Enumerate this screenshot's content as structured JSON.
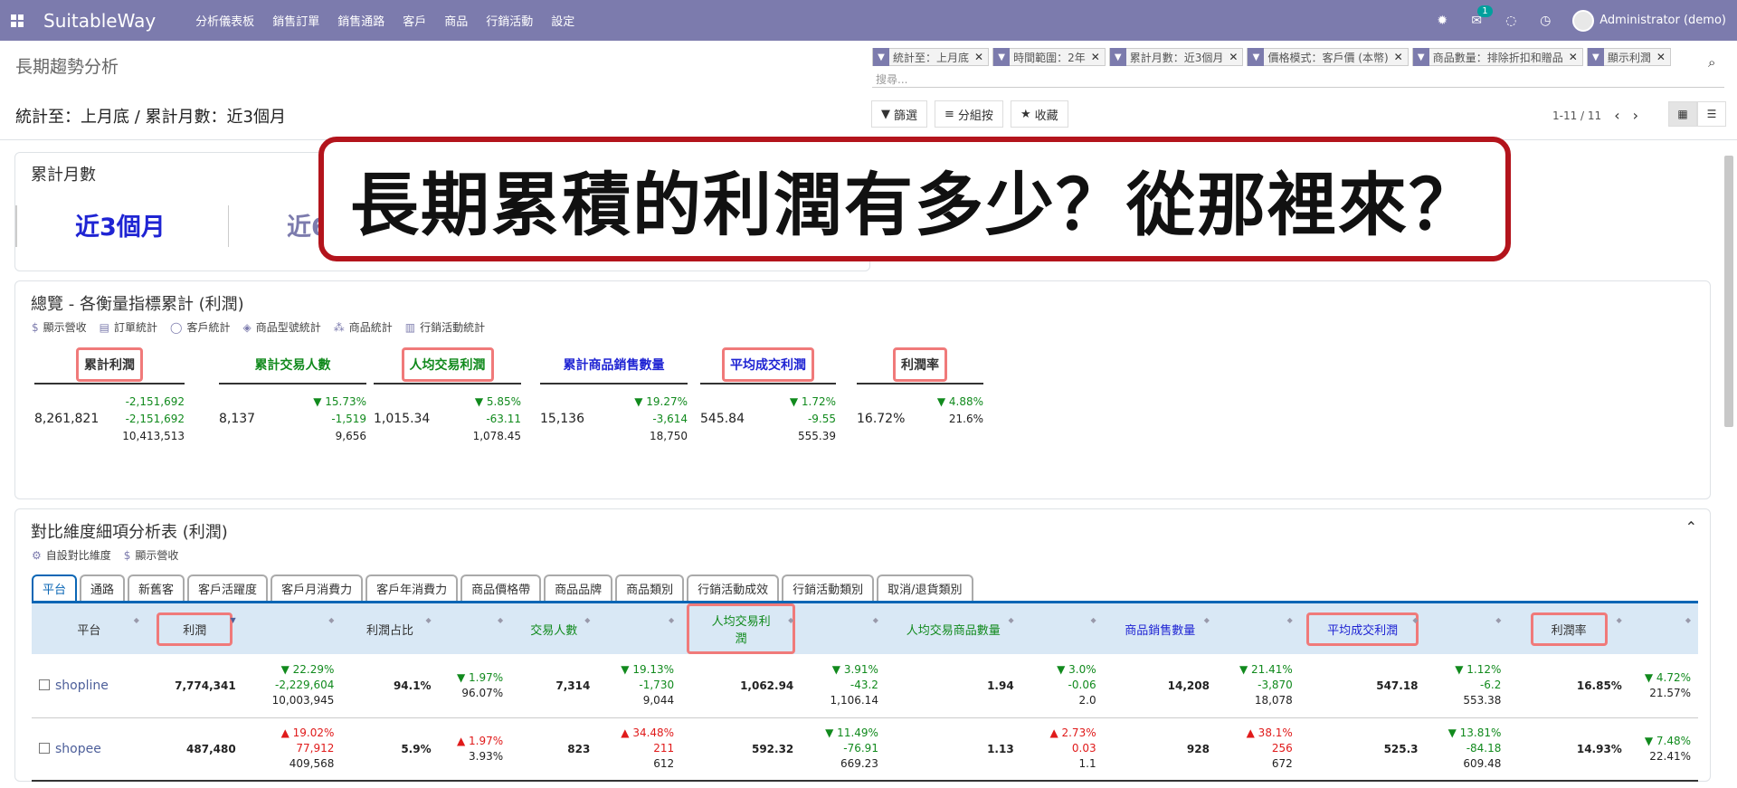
{
  "navbar": {
    "brand": "SuitableWay",
    "menu": [
      "分析儀表板",
      "銷售訂單",
      "銷售通路",
      "客戶",
      "商品",
      "行銷活動",
      "設定"
    ],
    "chat_count": "1",
    "user": "Administrator (demo)",
    "icons": [
      "bug-icon",
      "chat-icon",
      "activity-icon",
      "clock-icon"
    ]
  },
  "control_panel": {
    "title": "長期趨勢分析",
    "subtitle": "統計至：上月底 / 累計月數：近3個月",
    "facets": [
      "統計至：上月底",
      "時間範圍：2年",
      "累計月數：近3個月",
      "價格模式：客戶價 (本幣)",
      "商品數量：排除折扣和贈品",
      "顯示利潤"
    ],
    "search_placeholder": "搜尋...",
    "btn_filter": "篩選",
    "btn_group": "分組按",
    "btn_fav": "收藏",
    "pager": "1-11 / 11"
  },
  "months_card": {
    "title": "累計月數",
    "opt1": "近3個月",
    "opt2": "近6"
  },
  "callout": "長期累積的利潤有多少？從那裡來？",
  "overview": {
    "title": "總覽 - 各衡量指標累計 (利潤)",
    "links": [
      "顯示營收",
      "訂單統計",
      "客戶統計",
      "商品型號統計",
      "商品統計",
      "行銷活動統計"
    ],
    "kpis": [
      {
        "label": "累計利潤",
        "main": "8,261,821",
        "d1": "-2,151,692",
        "d2": "-2,151,692",
        "d3": "10,413,513"
      },
      {
        "label": "累計交易人數",
        "main": "8,137",
        "d1": "▼ 15.73%",
        "d2": "-1,519",
        "d3": "9,656"
      },
      {
        "label": "人均交易利潤",
        "main": "1,015.34",
        "d1": "▼ 5.85%",
        "d2": "-63.11",
        "d3": "1,078.45"
      },
      {
        "label": "累計商品銷售數量",
        "main": "15,136",
        "d1": "▼ 19.27%",
        "d2": "-3,614",
        "d3": "18,750"
      },
      {
        "label": "平均成交利潤",
        "main": "545.84",
        "d1": "▼ 1.72%",
        "d2": "-9.55",
        "d3": "555.39"
      },
      {
        "label": "利潤率",
        "main": "16.72%",
        "d1": "▼ 4.88%",
        "d2": "21.6%",
        "d3": ""
      }
    ]
  },
  "detail": {
    "title": "對比維度細項分析表 (利潤)",
    "links": [
      "自設對比維度",
      "顯示營收"
    ],
    "tabs": [
      "平台",
      "通路",
      "新舊客",
      "客戶活躍度",
      "客戶月消費力",
      "客戶年消費力",
      "商品價格帶",
      "商品品牌",
      "商品類別",
      "行銷活動成效",
      "行銷活動類別",
      "取消/退貨類別"
    ],
    "headers": [
      "平台",
      "利潤",
      "利潤占比",
      "交易人數",
      "人均交易利潤",
      "人均交易商品數量",
      "商品銷售數量",
      "平均成交利潤",
      "利潤率"
    ],
    "rows": [
      {
        "platform": "shopline",
        "profit": "7,774,341",
        "profit_d": [
          "▼ 22.29%",
          "-2,229,604",
          "10,003,945"
        ],
        "share": "94.1%",
        "share_d": [
          "▼ 1.97%",
          "96.07%"
        ],
        "buyers": "7,314",
        "buyers_d": [
          "▼ 19.13%",
          "-1,730",
          "9,044"
        ],
        "per_profit": "1,062.94",
        "per_profit_d": [
          "▼ 3.91%",
          "-43.2",
          "1,106.14"
        ],
        "per_qty": "1.94",
        "per_qty_d": [
          "▼ 3.0%",
          "-0.06",
          "2.0"
        ],
        "qty": "14,208",
        "qty_d": [
          "▼ 21.41%",
          "-3,870",
          "18,078"
        ],
        "avg": "547.18",
        "avg_d": [
          "▼ 1.12%",
          "-6.2",
          "553.38"
        ],
        "margin": "16.85%",
        "margin_d": [
          "▼ 4.72%",
          "21.57%"
        ]
      },
      {
        "platform": "shopee",
        "profit": "487,480",
        "profit_d": [
          "▲ 19.02%",
          "77,912",
          "409,568"
        ],
        "share": "5.9%",
        "share_d": [
          "▲ 1.97%",
          "3.93%"
        ],
        "buyers": "823",
        "buyers_d": [
          "▲ 34.48%",
          "211",
          "612"
        ],
        "per_profit": "592.32",
        "per_profit_d": [
          "▼ 11.49%",
          "-76.91",
          "669.23"
        ],
        "per_qty": "1.13",
        "per_qty_d": [
          "▲ 2.73%",
          "0.03",
          "1.1"
        ],
        "qty": "928",
        "qty_d": [
          "▲ 38.1%",
          "256",
          "672"
        ],
        "avg": "525.3",
        "avg_d": [
          "▼ 13.81%",
          "-84.18",
          "609.48"
        ],
        "margin": "14.93%",
        "margin_d": [
          "▼ 7.48%",
          "22.41%"
        ]
      }
    ]
  },
  "colors": {
    "nav": "#7c7bad",
    "green": "#118a1d",
    "red": "#e01a1a",
    "blue": "#1f24d3",
    "highlight": "#f07a7a",
    "callout_border": "#b3141c"
  }
}
